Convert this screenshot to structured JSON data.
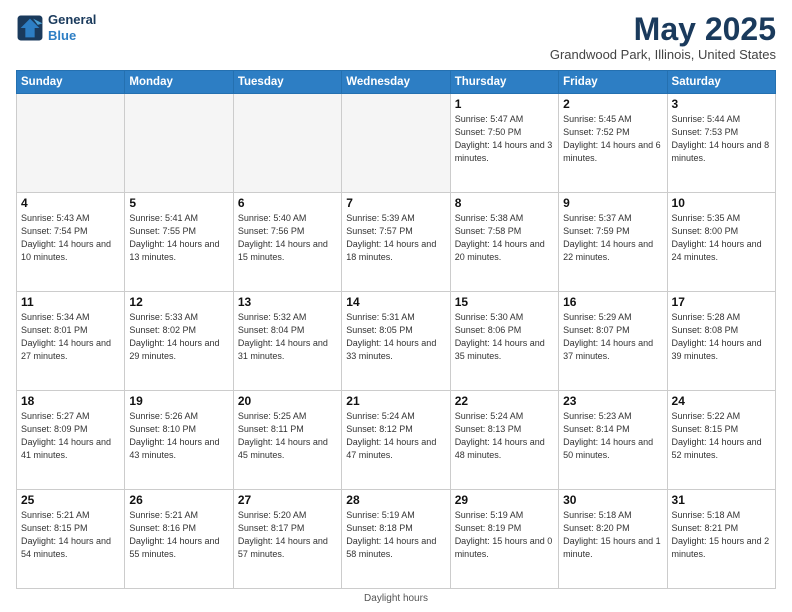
{
  "header": {
    "logo_line1": "General",
    "logo_line2": "Blue",
    "month_title": "May 2025",
    "location": "Grandwood Park, Illinois, United States"
  },
  "days_of_week": [
    "Sunday",
    "Monday",
    "Tuesday",
    "Wednesday",
    "Thursday",
    "Friday",
    "Saturday"
  ],
  "footer": "Daylight hours",
  "weeks": [
    [
      {
        "day": "",
        "info": ""
      },
      {
        "day": "",
        "info": ""
      },
      {
        "day": "",
        "info": ""
      },
      {
        "day": "",
        "info": ""
      },
      {
        "day": "1",
        "info": "Sunrise: 5:47 AM\nSunset: 7:50 PM\nDaylight: 14 hours\nand 3 minutes."
      },
      {
        "day": "2",
        "info": "Sunrise: 5:45 AM\nSunset: 7:52 PM\nDaylight: 14 hours\nand 6 minutes."
      },
      {
        "day": "3",
        "info": "Sunrise: 5:44 AM\nSunset: 7:53 PM\nDaylight: 14 hours\nand 8 minutes."
      }
    ],
    [
      {
        "day": "4",
        "info": "Sunrise: 5:43 AM\nSunset: 7:54 PM\nDaylight: 14 hours\nand 10 minutes."
      },
      {
        "day": "5",
        "info": "Sunrise: 5:41 AM\nSunset: 7:55 PM\nDaylight: 14 hours\nand 13 minutes."
      },
      {
        "day": "6",
        "info": "Sunrise: 5:40 AM\nSunset: 7:56 PM\nDaylight: 14 hours\nand 15 minutes."
      },
      {
        "day": "7",
        "info": "Sunrise: 5:39 AM\nSunset: 7:57 PM\nDaylight: 14 hours\nand 18 minutes."
      },
      {
        "day": "8",
        "info": "Sunrise: 5:38 AM\nSunset: 7:58 PM\nDaylight: 14 hours\nand 20 minutes."
      },
      {
        "day": "9",
        "info": "Sunrise: 5:37 AM\nSunset: 7:59 PM\nDaylight: 14 hours\nand 22 minutes."
      },
      {
        "day": "10",
        "info": "Sunrise: 5:35 AM\nSunset: 8:00 PM\nDaylight: 14 hours\nand 24 minutes."
      }
    ],
    [
      {
        "day": "11",
        "info": "Sunrise: 5:34 AM\nSunset: 8:01 PM\nDaylight: 14 hours\nand 27 minutes."
      },
      {
        "day": "12",
        "info": "Sunrise: 5:33 AM\nSunset: 8:02 PM\nDaylight: 14 hours\nand 29 minutes."
      },
      {
        "day": "13",
        "info": "Sunrise: 5:32 AM\nSunset: 8:04 PM\nDaylight: 14 hours\nand 31 minutes."
      },
      {
        "day": "14",
        "info": "Sunrise: 5:31 AM\nSunset: 8:05 PM\nDaylight: 14 hours\nand 33 minutes."
      },
      {
        "day": "15",
        "info": "Sunrise: 5:30 AM\nSunset: 8:06 PM\nDaylight: 14 hours\nand 35 minutes."
      },
      {
        "day": "16",
        "info": "Sunrise: 5:29 AM\nSunset: 8:07 PM\nDaylight: 14 hours\nand 37 minutes."
      },
      {
        "day": "17",
        "info": "Sunrise: 5:28 AM\nSunset: 8:08 PM\nDaylight: 14 hours\nand 39 minutes."
      }
    ],
    [
      {
        "day": "18",
        "info": "Sunrise: 5:27 AM\nSunset: 8:09 PM\nDaylight: 14 hours\nand 41 minutes."
      },
      {
        "day": "19",
        "info": "Sunrise: 5:26 AM\nSunset: 8:10 PM\nDaylight: 14 hours\nand 43 minutes."
      },
      {
        "day": "20",
        "info": "Sunrise: 5:25 AM\nSunset: 8:11 PM\nDaylight: 14 hours\nand 45 minutes."
      },
      {
        "day": "21",
        "info": "Sunrise: 5:24 AM\nSunset: 8:12 PM\nDaylight: 14 hours\nand 47 minutes."
      },
      {
        "day": "22",
        "info": "Sunrise: 5:24 AM\nSunset: 8:13 PM\nDaylight: 14 hours\nand 48 minutes."
      },
      {
        "day": "23",
        "info": "Sunrise: 5:23 AM\nSunset: 8:14 PM\nDaylight: 14 hours\nand 50 minutes."
      },
      {
        "day": "24",
        "info": "Sunrise: 5:22 AM\nSunset: 8:15 PM\nDaylight: 14 hours\nand 52 minutes."
      }
    ],
    [
      {
        "day": "25",
        "info": "Sunrise: 5:21 AM\nSunset: 8:15 PM\nDaylight: 14 hours\nand 54 minutes."
      },
      {
        "day": "26",
        "info": "Sunrise: 5:21 AM\nSunset: 8:16 PM\nDaylight: 14 hours\nand 55 minutes."
      },
      {
        "day": "27",
        "info": "Sunrise: 5:20 AM\nSunset: 8:17 PM\nDaylight: 14 hours\nand 57 minutes."
      },
      {
        "day": "28",
        "info": "Sunrise: 5:19 AM\nSunset: 8:18 PM\nDaylight: 14 hours\nand 58 minutes."
      },
      {
        "day": "29",
        "info": "Sunrise: 5:19 AM\nSunset: 8:19 PM\nDaylight: 15 hours\nand 0 minutes."
      },
      {
        "day": "30",
        "info": "Sunrise: 5:18 AM\nSunset: 8:20 PM\nDaylight: 15 hours\nand 1 minute."
      },
      {
        "day": "31",
        "info": "Sunrise: 5:18 AM\nSunset: 8:21 PM\nDaylight: 15 hours\nand 2 minutes."
      }
    ]
  ]
}
